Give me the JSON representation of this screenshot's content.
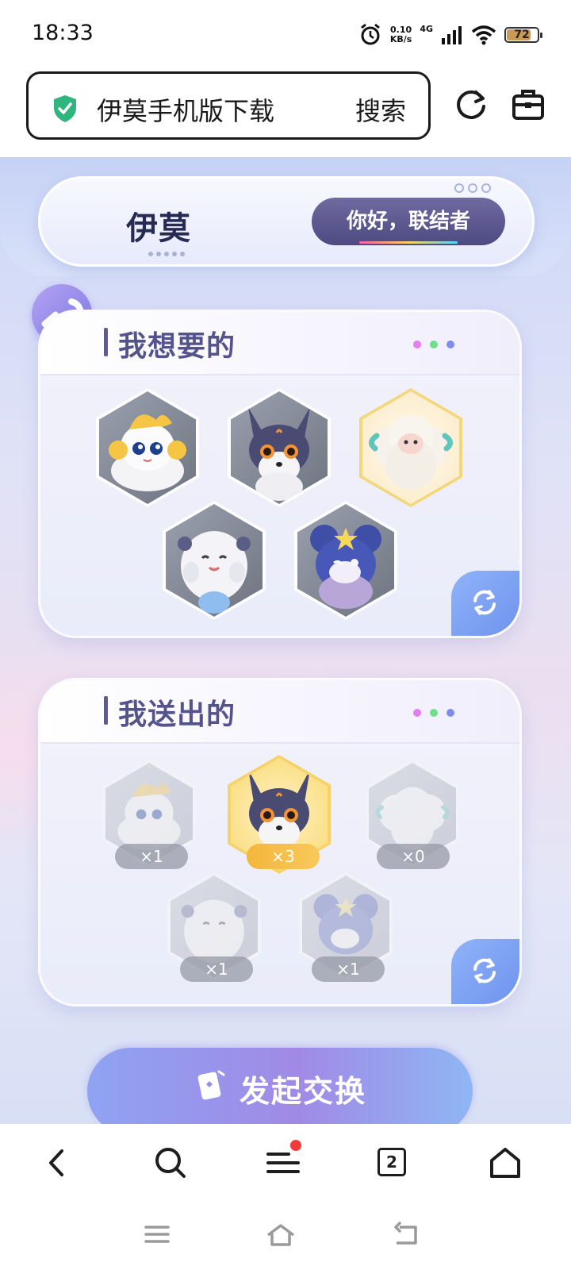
{
  "status_bar": {
    "time": "18:33",
    "net_speed_value": "0.10",
    "net_speed_unit": "KB/s",
    "network_type": "4G",
    "battery_level": "72",
    "battery_fraction": 0.72
  },
  "browser": {
    "address_text": "伊莫手机版下载",
    "search_label": "搜索"
  },
  "site": {
    "logo_text": "伊莫",
    "greeting": "你好，联结者",
    "want_section": {
      "title": "我想要的",
      "pets": [
        "fox-cat-gold",
        "black-fox",
        "sheep",
        "white-seal",
        "blue-mouse"
      ]
    },
    "give_section": {
      "title": "我送出的",
      "items": [
        {
          "pet": "fox-cat-gold",
          "count": "×1"
        },
        {
          "pet": "black-fox",
          "count": "×3"
        },
        {
          "pet": "sheep",
          "count": "×0"
        },
        {
          "pet": "white-seal",
          "count": "×1"
        },
        {
          "pet": "blue-mouse",
          "count": "×1"
        }
      ]
    },
    "cta_label": "发起交换"
  },
  "bottom_nav": {
    "tab_count": "2",
    "icons": [
      "back-icon",
      "search-icon",
      "menu-icon",
      "tabs-icon",
      "home-icon"
    ]
  },
  "colors": {
    "accent": "#54538c",
    "shield": "#2fb57e",
    "badge": "#f23b3b",
    "dot_pink": "#e07ef2",
    "dot_green": "#6fe08a",
    "dot_blue": "#7e8cf0"
  }
}
